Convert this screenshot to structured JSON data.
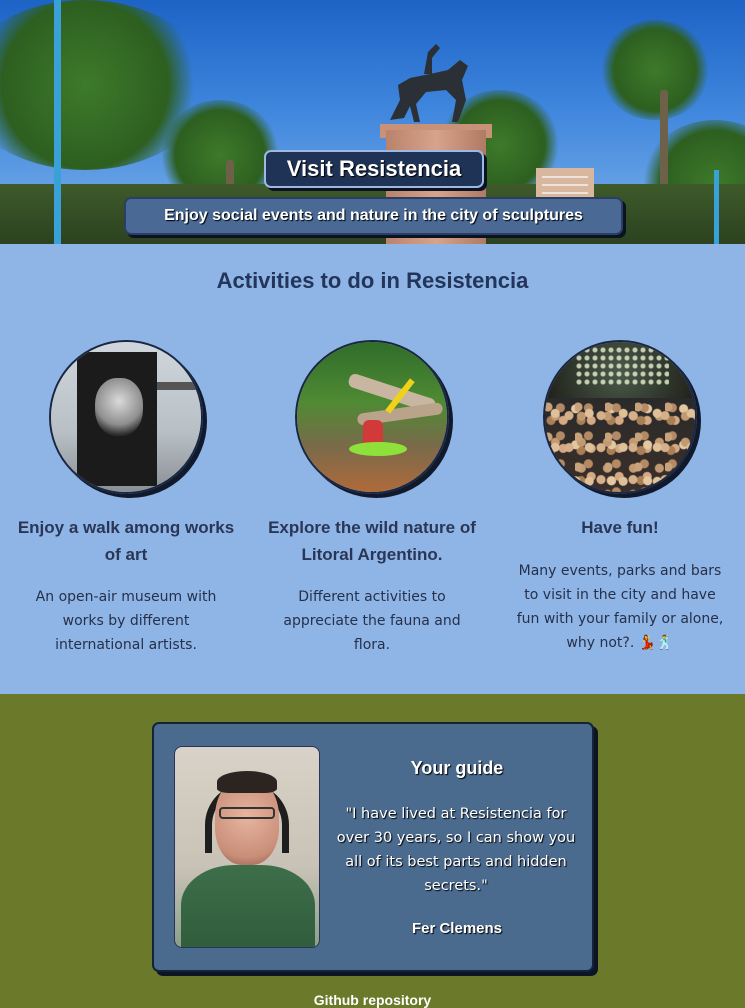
{
  "hero": {
    "title": "Visit Resistencia",
    "subtitle": "Enjoy social events and nature in the city of sculptures"
  },
  "activities": {
    "heading": "Activities to do in Resistencia",
    "cards": [
      {
        "title": "Enjoy a walk among works of art",
        "text": "An open-air museum with works by different international artists."
      },
      {
        "title": "Explore the wild nature of Litoral Argentino.",
        "text": "Different activities to appreciate the fauna and flora."
      },
      {
        "title": "Have fun!",
        "text": "Many events, parks and bars to visit in the city and have fun with your family or alone, why not?. 💃🕺"
      }
    ]
  },
  "guide": {
    "title": "Your guide",
    "quote": "\"I have lived at Resistencia for over 30 years, so I can show you all of its best parts and hidden secrets.\"",
    "name": "Fer Clemens"
  },
  "footer": {
    "link": "Github repository"
  },
  "colors": {
    "activities_bg": "#8fb5e7",
    "guide_bg": "#6b7a2a",
    "card_bg": "#4a6a8e",
    "title_box": "#1f3356"
  }
}
